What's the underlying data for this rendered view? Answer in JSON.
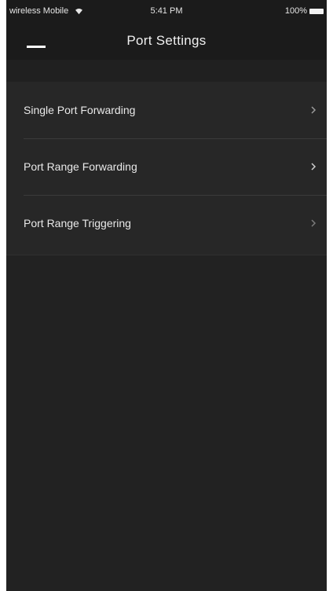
{
  "status_bar": {
    "carrier": "wireless Mobile",
    "time": "5:41 PM",
    "battery": "100%"
  },
  "nav": {
    "title": "Port Settings"
  },
  "settings": {
    "items": [
      {
        "label": "Single Port Forwarding"
      },
      {
        "label": "Port Range Forwarding"
      },
      {
        "label": "Port Range Triggering"
      }
    ]
  },
  "icons": {
    "back": "hamburger-back-icon",
    "chevron": "chevron-right-icon",
    "wifi": "wifi-icon",
    "battery": "battery-icon"
  },
  "colors": {
    "background": "#222222",
    "header": "#1b1b1b",
    "list_bg": "#272727",
    "text": "#e9e9e9",
    "divider": "#3b3b3b"
  }
}
